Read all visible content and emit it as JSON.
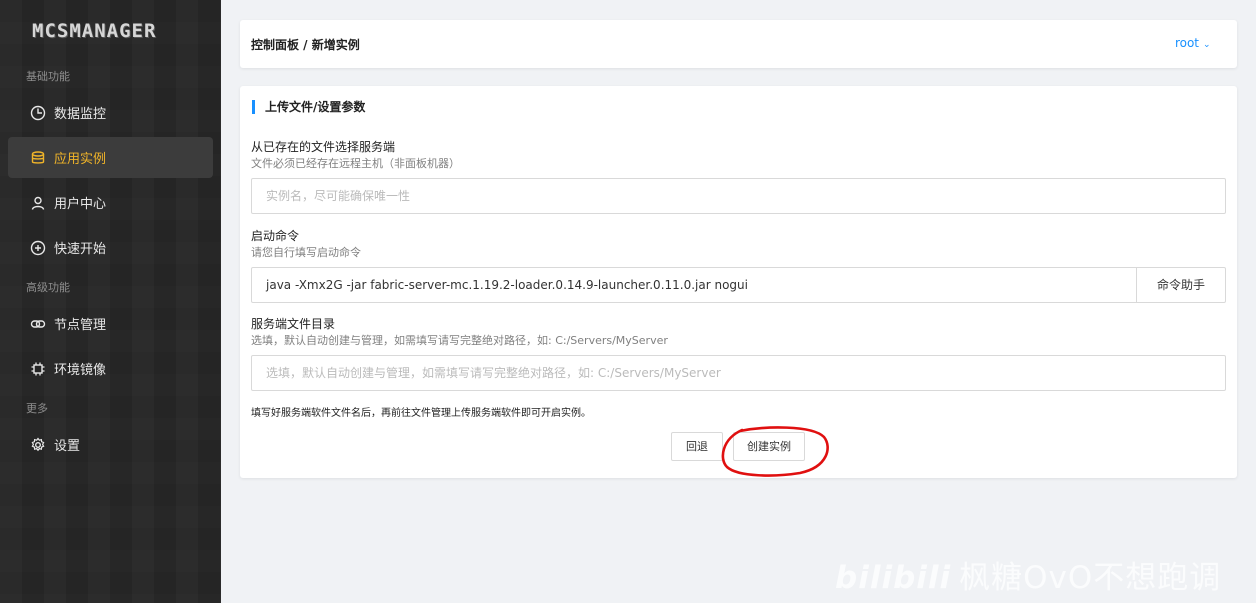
{
  "app": {
    "logo": "MCSMANAGER"
  },
  "sidebar": {
    "groups": [
      {
        "label": "基础功能"
      },
      {
        "label": "高级功能"
      },
      {
        "label": "更多"
      }
    ],
    "items": [
      {
        "label": "数据监控",
        "icon": "dashboard-icon"
      },
      {
        "label": "应用实例",
        "icon": "database-icon",
        "active": true
      },
      {
        "label": "用户中心",
        "icon": "user-icon"
      },
      {
        "label": "快速开始",
        "icon": "plus-circle-icon"
      },
      {
        "label": "节点管理",
        "icon": "link-icon"
      },
      {
        "label": "环境镜像",
        "icon": "chip-icon"
      },
      {
        "label": "设置",
        "icon": "gear-icon"
      }
    ]
  },
  "header": {
    "breadcrumb": "控制面板 / 新增实例",
    "user": "root"
  },
  "form": {
    "section_title": "上传文件/设置参数",
    "server_file": {
      "label": "从已存在的文件选择服务端",
      "hint": "文件必须已经存在远程主机（非面板机器）",
      "placeholder": "实例名，尽可能确保唯一性"
    },
    "start_command": {
      "label": "启动命令",
      "hint": "请您自行填写启动命令",
      "value": "java -Xmx2G -jar fabric-server-mc.1.19.2-loader.0.14.9-launcher.0.11.0.jar nogui",
      "helper_button": "命令助手"
    },
    "server_dir": {
      "label": "服务端文件目录",
      "hint": "选填，默认自动创建与管理，如需填写请写完整绝对路径，如: C:/Servers/MyServer",
      "placeholder": "选填，默认自动创建与管理，如需填写请写完整绝对路径，如: C:/Servers/MyServer"
    },
    "note": "填写好服务端软件文件名后，再前往文件管理上传服务端软件即可开启实例。",
    "back_button": "回退",
    "create_button": "创建实例"
  },
  "watermark": {
    "brand": "bilibili",
    "author": "枫糖OvO不想跑调"
  },
  "colors": {
    "accent": "#1890ff",
    "active": "#f0b429",
    "annotation": "#e01010"
  }
}
